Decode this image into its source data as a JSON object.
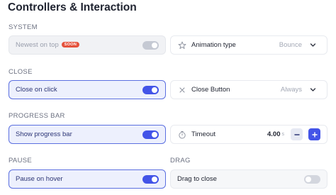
{
  "page": {
    "title": "Controllers & Interaction"
  },
  "sections": {
    "system": "SYSTEM",
    "close": "CLOSE",
    "progress": "PROGRESS BAR",
    "pause": "PAUSE",
    "drag": "DRAG"
  },
  "system": {
    "newest_on_top": {
      "label": "Newest on top",
      "badge": "SOON",
      "enabled": true,
      "disabled": true
    },
    "animation_type": {
      "label": "Animation type",
      "value": "Bounce",
      "icon": "sparkle-star-icon"
    }
  },
  "close": {
    "close_on_click": {
      "label": "Close on click",
      "enabled": true
    },
    "close_button": {
      "label": "Close Button",
      "value": "Always",
      "icon": "close-icon"
    }
  },
  "progress": {
    "show_progress_bar": {
      "label": "Show progress bar",
      "enabled": true
    },
    "timeout": {
      "label": "Timeout",
      "value": "4.00",
      "unit": "s",
      "icon": "stopwatch-icon"
    }
  },
  "pause": {
    "pause_on_hover": {
      "label": "Pause on hover",
      "enabled": true
    }
  },
  "drag": {
    "drag_to_close": {
      "label": "Drag to close",
      "enabled": false
    }
  },
  "colors": {
    "accent": "#4354e8",
    "active_border": "#5b6fe0",
    "active_bg": "#edf0fd",
    "badge": "#e5533d"
  }
}
